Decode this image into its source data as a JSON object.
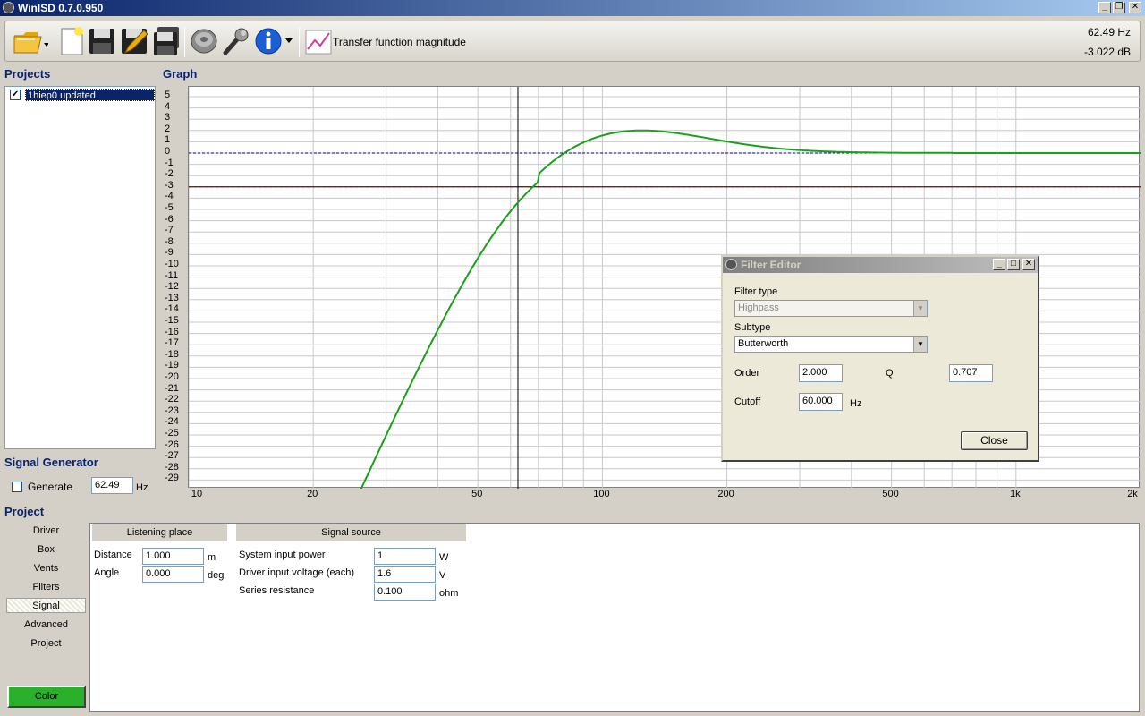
{
  "window": {
    "title": "WinISD 0.7.0.950"
  },
  "toolbar": {
    "graph_label": "Transfer function magnitude",
    "readout_hz": "62.49 Hz",
    "readout_db": "-3.022 dB"
  },
  "projects": {
    "heading": "Projects",
    "items": [
      {
        "label": "1hiep0 updated",
        "checked": true
      }
    ]
  },
  "graph": {
    "heading": "Graph",
    "y_ticks": [
      "5",
      "4",
      "3",
      "2",
      "1",
      "0",
      "-1",
      "-2",
      "-3",
      "-4",
      "-5",
      "-6",
      "-7",
      "-8",
      "-9",
      "-10",
      "-11",
      "-12",
      "-13",
      "-14",
      "-15",
      "-16",
      "-17",
      "-18",
      "-19",
      "-20",
      "-21",
      "-22",
      "-23",
      "-24",
      "-25",
      "-26",
      "-27",
      "-28",
      "-29"
    ],
    "x_ticks": [
      "10",
      "20",
      "50",
      "100",
      "200",
      "500",
      "1k",
      "2k"
    ],
    "cursor_hz": 62.49,
    "cursor_db": -3.022
  },
  "signal_generator": {
    "heading": "Signal Generator",
    "generate_label": "Generate",
    "value": "62.49",
    "unit": "Hz"
  },
  "project_panel": {
    "heading": "Project",
    "nav": [
      "Driver",
      "Box",
      "Vents",
      "Filters",
      "Signal",
      "Advanced",
      "Project"
    ],
    "active_nav": "Signal",
    "color_label": "Color",
    "color_value": "#2ab02a",
    "listening_place": {
      "header": "Listening place",
      "distance_label": "Distance",
      "distance_value": "1.000",
      "distance_unit": "m",
      "angle_label": "Angle",
      "angle_value": "0.000",
      "angle_unit": "deg"
    },
    "signal_source": {
      "header": "Signal source",
      "power_label": "System input power",
      "power_value": "1",
      "power_unit": "W",
      "voltage_label": "Driver input voltage (each)",
      "voltage_value": "1.6",
      "voltage_unit": "V",
      "resistance_label": "Series resistance",
      "resistance_value": "0.100",
      "resistance_unit": "ohm"
    }
  },
  "filter_editor": {
    "title": "Filter Editor",
    "filter_type_label": "Filter type",
    "filter_type_value": "Highpass",
    "subtype_label": "Subtype",
    "subtype_value": "Butterworth",
    "order_label": "Order",
    "order_value": "2.000",
    "q_label": "Q",
    "q_value": "0.707",
    "cutoff_label": "Cutoff",
    "cutoff_value": "60.000",
    "cutoff_unit": "Hz",
    "close_label": "Close"
  },
  "colors": {
    "curve": "#1aa11a",
    "title_active": "#0a246a",
    "ref_line": "#00008b",
    "cursor_line": "#8b0000"
  },
  "icons": [
    "open-folder-icon",
    "new-file-icon",
    "save-icon",
    "edit-icon",
    "save-all-icon",
    "speaker-icon",
    "wrench-icon",
    "info-icon",
    "graph-icon"
  ]
}
